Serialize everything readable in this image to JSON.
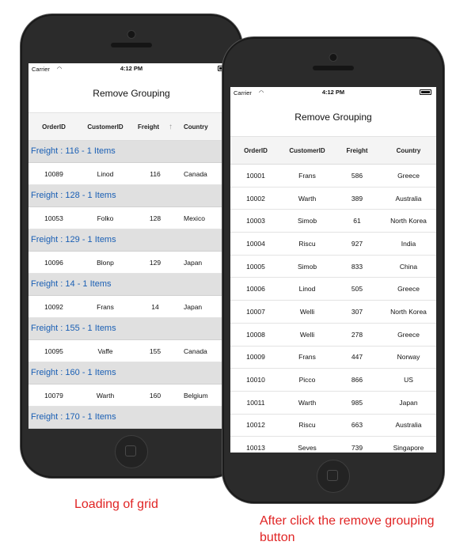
{
  "left_phone": {
    "status": {
      "carrier": "Carrier",
      "time": "4:12 PM"
    },
    "title": "Remove Grouping",
    "columns": [
      "OrderID",
      "CustomerID",
      "Freight",
      "Country"
    ],
    "sort_indicator": "↑",
    "groups": [
      {
        "label": "Freight : 116 - 1 Items",
        "row": [
          "10089",
          "Linod",
          "116",
          "Canada"
        ]
      },
      {
        "label": "Freight : 128 - 1 Items",
        "row": [
          "10053",
          "Folko",
          "128",
          "Mexico"
        ]
      },
      {
        "label": "Freight : 129 - 1 Items",
        "row": [
          "10096",
          "Blonp",
          "129",
          "Japan"
        ]
      },
      {
        "label": "Freight : 14 - 1 Items",
        "row": [
          "10092",
          "Frans",
          "14",
          "Japan"
        ]
      },
      {
        "label": "Freight : 155 - 1 Items",
        "row": [
          "10095",
          "Vaffe",
          "155",
          "Canada"
        ]
      },
      {
        "label": "Freight : 160 - 1 Items",
        "row": [
          "10079",
          "Warth",
          "160",
          "Belgium"
        ]
      },
      {
        "label": "Freight : 170 - 1 Items",
        "row": null
      }
    ]
  },
  "right_phone": {
    "status": {
      "carrier": "Carrier",
      "time": "4:12 PM"
    },
    "title": "Remove Grouping",
    "columns": [
      "OrderID",
      "CustomerID",
      "Freight",
      "Country"
    ],
    "rows": [
      [
        "10001",
        "Frans",
        "586",
        "Greece"
      ],
      [
        "10002",
        "Warth",
        "389",
        "Australia"
      ],
      [
        "10003",
        "Simob",
        "61",
        "North Korea"
      ],
      [
        "10004",
        "Riscu",
        "927",
        "India"
      ],
      [
        "10005",
        "Simob",
        "833",
        "China"
      ],
      [
        "10006",
        "Linod",
        "505",
        "Greece"
      ],
      [
        "10007",
        "Welli",
        "307",
        "North Korea"
      ],
      [
        "10008",
        "Welli",
        "278",
        "Greece"
      ],
      [
        "10009",
        "Frans",
        "447",
        "Norway"
      ],
      [
        "10010",
        "Picco",
        "866",
        "US"
      ],
      [
        "10011",
        "Warth",
        "985",
        "Japan"
      ],
      [
        "10012",
        "Riscu",
        "663",
        "Australia"
      ],
      [
        "10013",
        "Seves",
        "739",
        "Singapore"
      ]
    ]
  },
  "captions": {
    "left": "Loading of grid",
    "right": "After click the remove grouping button"
  },
  "colors": {
    "caption": "#e02424",
    "group_text": "#1a5fb4",
    "group_bg": "#e0e0e0",
    "phone_body": "#2b2b2b"
  }
}
